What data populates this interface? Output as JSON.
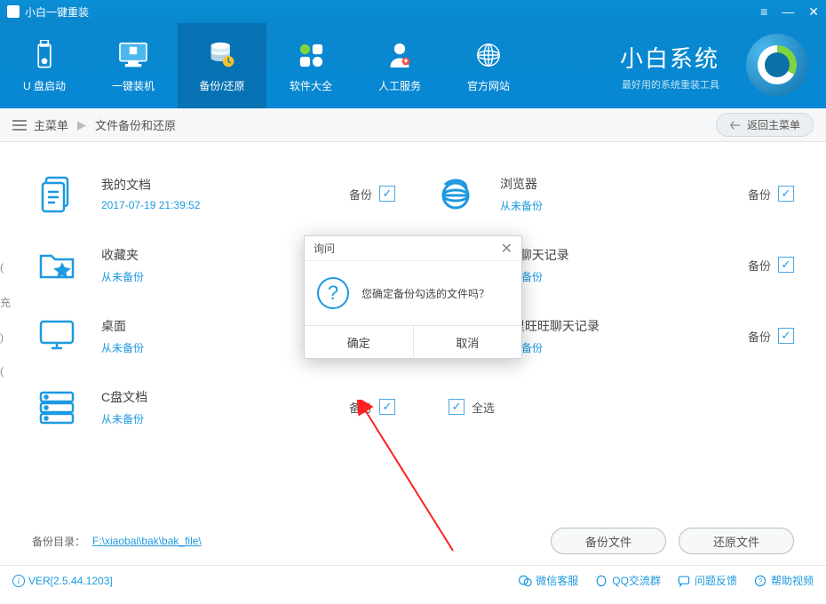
{
  "titlebar": {
    "appName": "小白一键重装"
  },
  "nav": {
    "items": [
      {
        "label": "U 盘启动"
      },
      {
        "label": "一键装机"
      },
      {
        "label": "备份/还原"
      },
      {
        "label": "软件大全"
      },
      {
        "label": "人工服务"
      },
      {
        "label": "官方网站"
      }
    ],
    "activeIndex": 2
  },
  "brand": {
    "title": "小白系统",
    "subtitle": "最好用的系统重装工具"
  },
  "breadcrumb": {
    "root": "主菜单",
    "current": "文件备份和还原",
    "back": "返回主菜单"
  },
  "backupLabel": "备份",
  "items": [
    {
      "title": "我的文档",
      "status": "2017-07-19 21:39:52",
      "checked": true
    },
    {
      "title": "浏览器",
      "status": "从未备份",
      "checked": true
    },
    {
      "title": "收藏夹",
      "status": "从未备份",
      "checked": true
    },
    {
      "title": "QQ聊天记录",
      "status": "从未备份",
      "checked": true
    },
    {
      "title": "桌面",
      "status": "从未备份",
      "checked": true
    },
    {
      "title": "阿里旺旺聊天记录",
      "status": "从未备份",
      "checked": true
    },
    {
      "title": "C盘文档",
      "status": "从未备份",
      "checked": true
    }
  ],
  "selectAll": {
    "label": "全选",
    "checked": true
  },
  "path": {
    "label": "备份目录：",
    "value": "F:\\xiaobai\\bak\\bak_file\\"
  },
  "buttons": {
    "backup": "备份文件",
    "restore": "还原文件"
  },
  "statusbar": {
    "version": "VER[2.5.44.1203]",
    "links": [
      {
        "label": "微信客服"
      },
      {
        "label": "QQ交流群"
      },
      {
        "label": "问题反馈"
      },
      {
        "label": "帮助视频"
      }
    ]
  },
  "modal": {
    "title": "询问",
    "message": "您确定备份勾选的文件吗？",
    "ok": "确定",
    "cancel": "取消"
  }
}
